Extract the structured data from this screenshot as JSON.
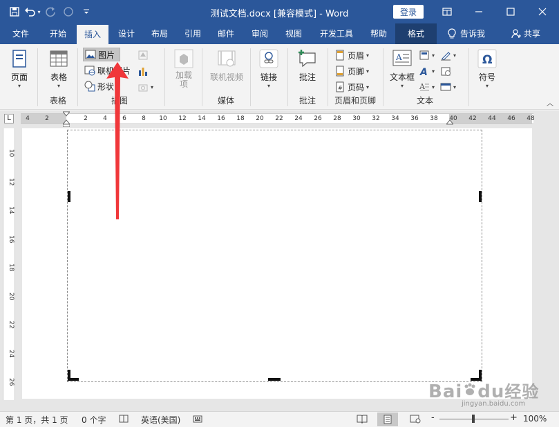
{
  "app": {
    "title": "测试文档.docx [兼容模式] - Word",
    "login_label": "登录"
  },
  "tabs": [
    "文件",
    "开始",
    "插入",
    "设计",
    "布局",
    "引用",
    "邮件",
    "审阅",
    "视图",
    "开发工具",
    "帮助",
    "格式"
  ],
  "tell_me": "告诉我",
  "share": "共享",
  "ribbon": {
    "pages": {
      "label": "页面",
      "group": ""
    },
    "tables": {
      "label": "表格",
      "group": "表格"
    },
    "illustrations": {
      "picture": "图片",
      "online_picture": "联机图片",
      "shapes": "形状",
      "group": "插图"
    },
    "addins": {
      "label": "加载\n项"
    },
    "media": {
      "label": "联机视频",
      "group": "媒体"
    },
    "links": {
      "label": "链接"
    },
    "comments": {
      "label": "批注",
      "group": "批注"
    },
    "header_footer": {
      "header": "页眉",
      "footer": "页脚",
      "page_number": "页码",
      "group": "页眉和页脚"
    },
    "text": {
      "textbox": "文本框",
      "group": "文本"
    },
    "symbols": {
      "label": "符号"
    }
  },
  "ruler": {
    "h_ticks": [
      "4",
      "2",
      "",
      "2",
      "4",
      "6",
      "8",
      "10",
      "12",
      "14",
      "16",
      "18",
      "20",
      "22",
      "24",
      "26",
      "28",
      "30",
      "32",
      "34",
      "36",
      "38",
      "40",
      "42",
      "44",
      "46",
      "48"
    ],
    "v_ticks": [
      "10",
      "12",
      "14",
      "16",
      "18",
      "20",
      "22",
      "24",
      "26"
    ]
  },
  "status": {
    "page": "第 1 页，共 1 页",
    "words": "0 个字",
    "language": "英语(美国)",
    "zoom": "100%",
    "zoom_minus": "-",
    "zoom_plus": "+"
  },
  "watermark": {
    "brand": "Bai",
    "paw": "du",
    "suffix": "经验",
    "url": "jingyan.baidu.com"
  },
  "colors": {
    "accent": "#2b579a",
    "arrow": "#f0373a"
  }
}
